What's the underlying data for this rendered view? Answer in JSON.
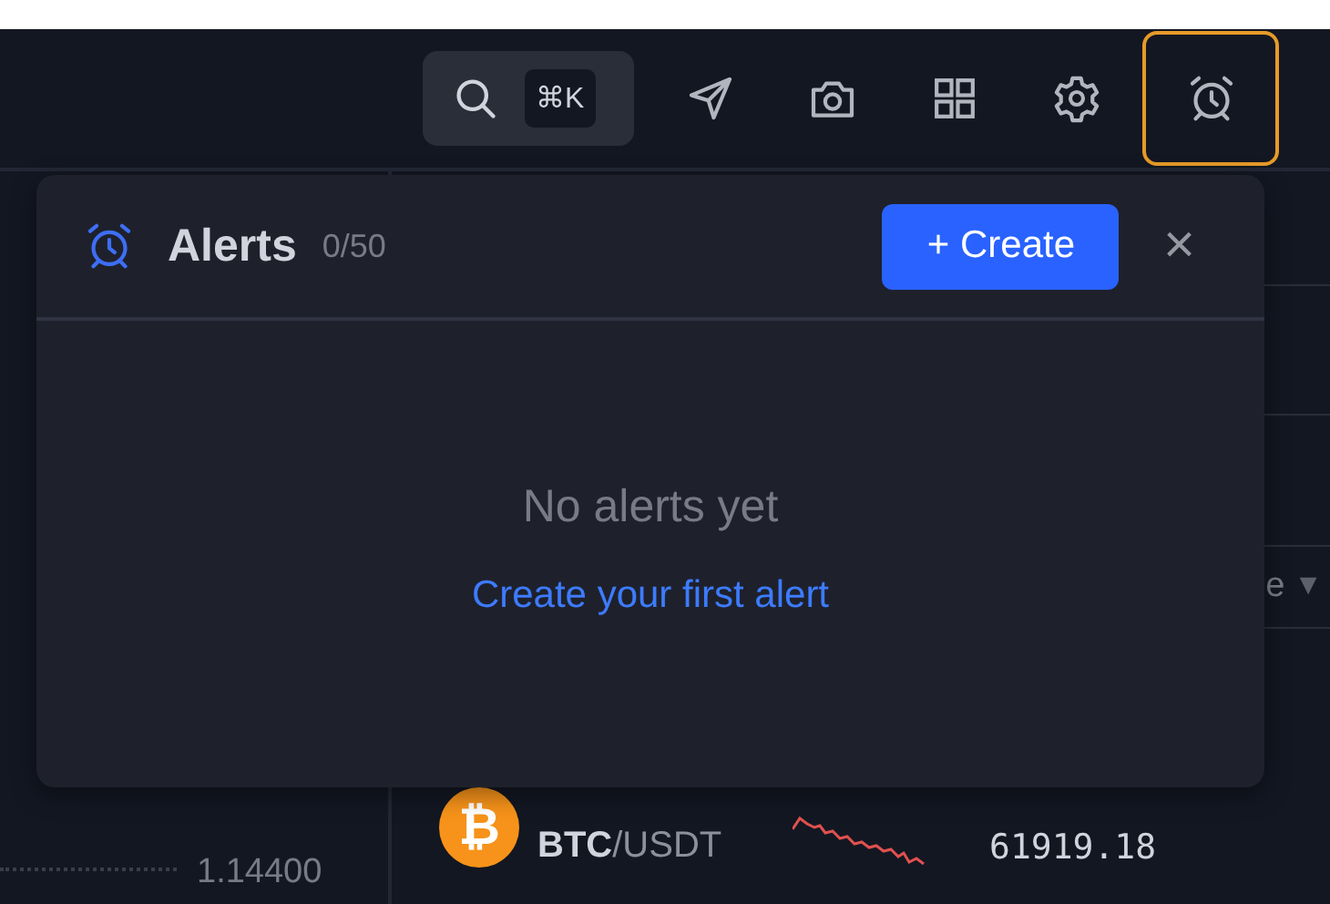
{
  "toolbar": {
    "search": {
      "shortcut": "⌘K"
    },
    "buttons": [
      {
        "kind": "send",
        "selected": false
      },
      {
        "kind": "camera",
        "selected": false
      },
      {
        "kind": "layout",
        "selected": false
      },
      {
        "kind": "settings",
        "selected": false
      },
      {
        "kind": "alarm",
        "selected": true
      }
    ]
  },
  "alerts_panel": {
    "title": "Alerts",
    "count": "0/50",
    "create_button": "+ Create",
    "close": "×",
    "empty_title": "No alerts yet",
    "empty_link": "Create your first alert"
  },
  "background": {
    "price_axis_label": "1.14400",
    "column_header_fragment": "e",
    "column_caret": "▼",
    "ticker": {
      "coin_symbol": "₿",
      "base": "BTC",
      "quote": "/USDT",
      "price": "61919.18"
    }
  }
}
